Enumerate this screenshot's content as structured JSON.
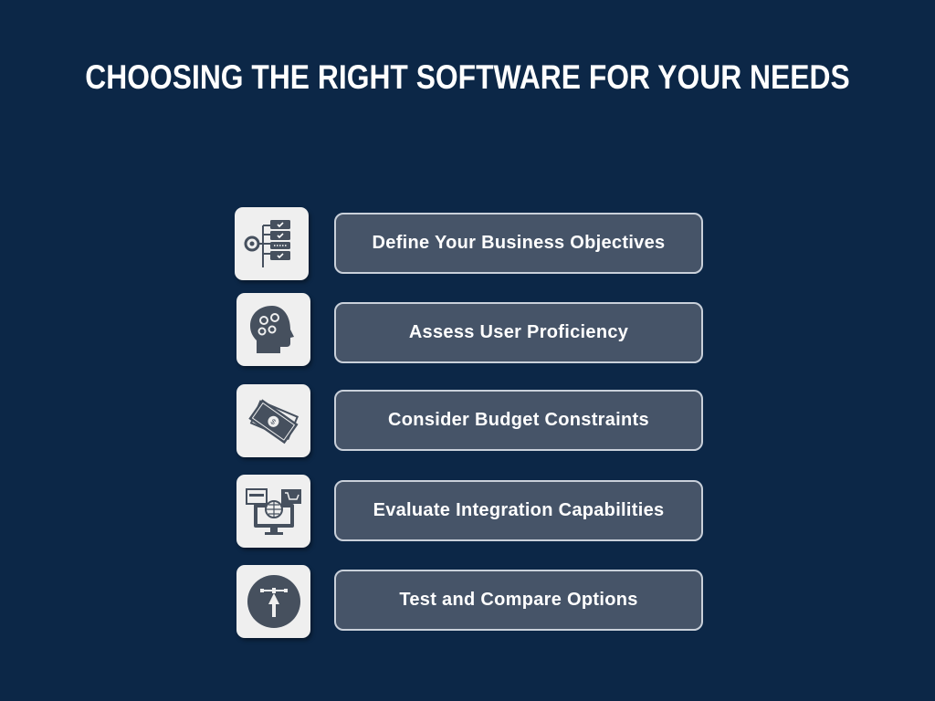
{
  "title": "CHOOSING THE RIGHT SOFTWARE FOR YOUR NEEDS",
  "colors": {
    "background": "#0c2747",
    "box": "#465468",
    "tile": "#efefef",
    "icon": "#46505e"
  },
  "steps": [
    {
      "label": "Define Your Business Objectives",
      "icon": "checklist-target-icon"
    },
    {
      "label": "Assess User Proficiency",
      "icon": "brain-gears-head-icon"
    },
    {
      "label": "Consider Budget Constraints",
      "icon": "money-bills-icon"
    },
    {
      "label": "Evaluate Integration Capabilities",
      "icon": "monitor-globe-cart-icon"
    },
    {
      "label": "Test and Compare Options",
      "icon": "pen-tool-icon"
    }
  ]
}
